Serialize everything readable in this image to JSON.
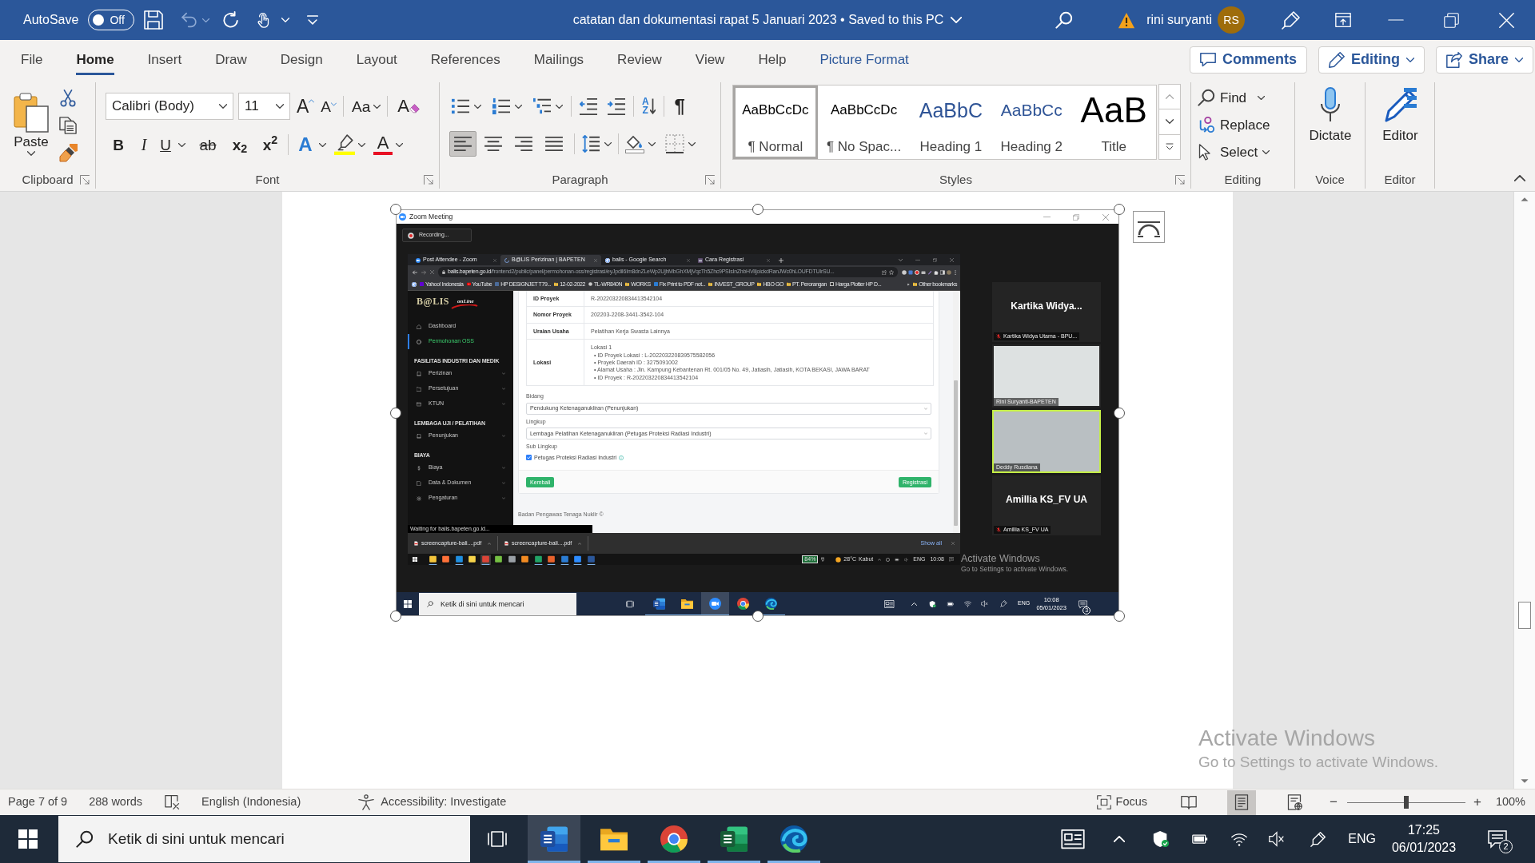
{
  "window": {
    "autosave_label": "AutoSave",
    "autosave": {
      "on": false,
      "label": "Off"
    },
    "title": "catatan dan dokumentasi rapat 5 Januari 2023 • Saved to this PC",
    "user_name": "rini suryanti",
    "user_initials": "RS"
  },
  "tabs": [
    {
      "label": "File",
      "kind": "standard",
      "selected": false
    },
    {
      "label": "Home",
      "kind": "standard",
      "selected": true
    },
    {
      "label": "Insert",
      "kind": "standard",
      "selected": false
    },
    {
      "label": "Draw",
      "kind": "standard",
      "selected": false
    },
    {
      "label": "Design",
      "kind": "standard",
      "selected": false
    },
    {
      "label": "Layout",
      "kind": "standard",
      "selected": false
    },
    {
      "label": "References",
      "kind": "standard",
      "selected": false
    },
    {
      "label": "Mailings",
      "kind": "standard",
      "selected": false
    },
    {
      "label": "Review",
      "kind": "standard",
      "selected": false
    },
    {
      "label": "View",
      "kind": "standard",
      "selected": false
    },
    {
      "label": "Help",
      "kind": "standard",
      "selected": false
    },
    {
      "label": "Picture Format",
      "kind": "contextual",
      "selected": false
    }
  ],
  "header_buttons": [
    {
      "label": "Comments",
      "dropdown": false
    },
    {
      "label": "Editing",
      "dropdown": true
    },
    {
      "label": "Share",
      "dropdown": true
    }
  ],
  "ribbon": {
    "clipboard": {
      "paste": "Paste",
      "label": "Clipboard"
    },
    "font": {
      "font_name": "Calibri (Body)",
      "font_size": "11",
      "grow": "A",
      "shrink": "A",
      "change_case": "Aa",
      "clear": "A",
      "bold": "B",
      "italic": "I",
      "underline": "U",
      "strikethrough": "ab",
      "subscript": "x$_{2}$",
      "superscript": "x$^{2}$",
      "text_effects": "A",
      "font_color": "A",
      "label": "Font"
    },
    "paragraph": {
      "sort": "AZ",
      "show_marks": "¶",
      "alignment": [
        {
          "selected": true
        },
        {
          "selected": false
        },
        {
          "selected": false
        },
        {
          "selected": false
        }
      ],
      "label": "Paragraph"
    },
    "styles": {
      "items": [
        {
          "kind": "normal",
          "preview": "AaBbCcDc",
          "name": "¶ Normal",
          "selected": true
        },
        {
          "kind": "no_spacing",
          "preview": "AaBbCcDc",
          "name": "¶ No Spac...",
          "selected": false
        },
        {
          "kind": "heading1",
          "preview": "AaBbC",
          "name": "Heading 1",
          "selected": false
        },
        {
          "kind": "heading2",
          "preview": "AaBbCc",
          "name": "Heading 2",
          "selected": false
        },
        {
          "kind": "title",
          "preview": "AaB",
          "name": "Title",
          "selected": false
        }
      ],
      "label": "Styles"
    },
    "editing": {
      "find": "Find",
      "replace": "Replace",
      "select": "Select",
      "label": "Editing"
    },
    "voice": {
      "dictate": "Dictate",
      "label": "Voice"
    },
    "editor": {
      "editor": "Editor",
      "label": "Editor"
    }
  },
  "document": {
    "zoom_meeting": {
      "title": "Zoom Meeting",
      "recording": "Recording...",
      "browser": {
        "tabs": [
          {
            "label": "Post Attendee - Zoom",
            "selected": false
          },
          {
            "label": "B@LIS Perizinan | BAPETEN",
            "selected": true
          },
          {
            "label": "balis - Google Search",
            "selected": false
          },
          {
            "label": "Cara Registrasi",
            "selected": false
          }
        ],
        "url_host": "balis.bapeten.go.id",
        "url_path": "/frontend2/public/panel/permohonan-oss/registrasi/eyJpdiI6Im8dnZLeWp2UjhMbGhXMjVqcTh5Zhc9PSIsInZhbHVlIjoickdRanJWc0hLOUFDTUIrSU...",
        "bookmarks": [
          "Yahoo! Indonesia",
          "YouTube",
          "HP DESIGNJET T79...",
          "12-02-2022",
          "TL-WR840N",
          "WORKS",
          "Fix Print to PDF not...",
          "INVEST_GROUP",
          "HBO GO",
          "PT. Perorangan",
          "Harga Plotter HP D..."
        ],
        "other_bookmarks": "Other bookmarks",
        "site": {
          "logo": "B@LIS",
          "logo_sub": "onLine",
          "nav": [
            {
              "items": [
                {
                  "label": "Dashboard",
                  "selected": false,
                  "submenu": false
                },
                {
                  "label": "Permohonan OSS",
                  "selected": true,
                  "submenu": false
                }
              ]
            },
            {
              "heading": "FASILITAS INDUSTRI DAN MEDIK",
              "items": [
                {
                  "label": "Perizinan",
                  "selected": false,
                  "submenu": true
                },
                {
                  "label": "Persetujuan",
                  "selected": false,
                  "submenu": true
                },
                {
                  "label": "KTUN",
                  "selected": false,
                  "submenu": true
                }
              ]
            },
            {
              "heading": "LEMBAGA UJI / PELATIHAN",
              "items": [
                {
                  "label": "Penunjukan",
                  "selected": false,
                  "submenu": true
                }
              ]
            },
            {
              "heading": "BIAYA",
              "items": [
                {
                  "label": "Biaya",
                  "selected": false,
                  "submenu": true
                },
                {
                  "label": "Data & Dokumen",
                  "selected": false,
                  "submenu": true
                },
                {
                  "label": "Pengaturan",
                  "selected": false,
                  "submenu": true
                }
              ]
            }
          ],
          "details": [
            {
              "label": "ID Proyek",
              "value": "R-202203220834413542104"
            },
            {
              "label": "Nomor Proyek",
              "value": "202203-2208-3441-3542-104"
            },
            {
              "label": "Uraian Usaha",
              "value": "Pelatihan Kerja Swasta Lainnya"
            },
            {
              "label": "Lokasi",
              "value": "Lokasi 1",
              "bullets": [
                "• ID Proyek Lokasi : L-202203220839575582056",
                "• Proyek Daerah ID : 3275091002",
                "• Alamat Usaha : Jln. Kampung Kebantenan Rt. 001/05 No. 49, Jatiasih, Jatiasih, KOTA BEKASI, JAWA BARAT",
                "• ID Proyek : R-202203220834413542104"
              ]
            }
          ],
          "selects": [
            {
              "label": "Bidang",
              "value": "Pendukung Ketenaganukliran (Penunjukan)"
            },
            {
              "label": "Lingkup",
              "value": "Lembaga Pelatihan Ketenaganukliran (Petugas Proteksi Radiasi Industri)"
            }
          ],
          "sub_scope": {
            "label": "Sub Lingkup",
            "options": [
              {
                "label": "Petugas Proteksi Radiasi Industri",
                "checked": true
              }
            ]
          },
          "back_button": "Kembali",
          "submit_button": "Registrasi",
          "footer": "Badan Pengawas Tenaga Nuklir ©"
        },
        "status": "Waiting for balis.bapeten.go.id...",
        "downloads": [
          "screencapture-bali....pdf",
          "screencapture-bali....pdf"
        ],
        "show_all": "Show all",
        "shared_taskbar": {
          "apps": [
            {
              "running": true,
              "selected": false
            },
            {
              "running": false,
              "selected": false
            },
            {
              "running": true,
              "selected": false
            },
            {
              "running": false,
              "selected": false
            },
            {
              "running": true,
              "selected": true
            },
            {
              "running": false,
              "selected": false
            },
            {
              "running": false,
              "selected": false
            },
            {
              "running": false,
              "selected": false
            },
            {
              "running": true,
              "selected": false
            },
            {
              "running": true,
              "selected": false
            },
            {
              "running": true,
              "selected": false
            },
            {
              "running": true,
              "selected": false
            },
            {
              "running": true,
              "selected": false
            }
          ],
          "battery": "84%",
          "temperature": "28°C",
          "weather": "Kabut",
          "language": "ENG",
          "time": "10:08"
        }
      },
      "participants": [
        {
          "kind": "name_tile",
          "name": "Kartika Widya...",
          "label": "Kartika Widya Utama - BPU...",
          "muted": true,
          "speaking": false
        },
        {
          "kind": "video",
          "label": "Rini Suryanti-BAPETEN",
          "muted": false,
          "speaking": false
        },
        {
          "kind": "video",
          "label": "Deddy Rusdiana",
          "muted": false,
          "speaking": true
        },
        {
          "kind": "name_tile",
          "name": "Amillia KS_FV UA",
          "label": "Amillia KS_FV UA",
          "muted": true,
          "speaking": false
        }
      ],
      "activation": {
        "title": "Activate Windows",
        "hint": "Go to Settings to activate Windows."
      },
      "taskbar": {
        "search_placeholder": "Ketik di sini untuk mencari",
        "apps": [
          {
            "running": true,
            "selected": false
          },
          {
            "running": true,
            "selected": false
          },
          {
            "running": true,
            "selected": true
          },
          {
            "running": false,
            "selected": false
          },
          {
            "running": true,
            "selected": false
          }
        ],
        "language": "ENG",
        "time": "10:08",
        "date": "05/01/2023",
        "notifications": "3"
      }
    },
    "activation": {
      "title": "Activate Windows",
      "hint": "Go to Settings to activate Windows."
    }
  },
  "status_bar": {
    "page": "Page 7 of 9",
    "words": "288 words",
    "language": "English (Indonesia)",
    "accessibility": "Accessibility: Investigate",
    "focus": "Focus",
    "views": [
      {
        "selected": false
      },
      {
        "selected": true
      },
      {
        "selected": false
      }
    ],
    "zoom_out": "−",
    "zoom_slider": {
      "level": 0.5
    },
    "zoom_in": "+",
    "zoom": "100%"
  },
  "taskbar": {
    "search_placeholder": "Ketik di sini untuk mencari",
    "apps": [
      {
        "selected": true,
        "running": true
      },
      {
        "selected": false,
        "running": true
      },
      {
        "selected": false,
        "running": true
      },
      {
        "selected": false,
        "running": true
      },
      {
        "selected": false,
        "running": true
      }
    ],
    "language": "ENG",
    "time": "17:25",
    "date": "06/01/2023",
    "notifications": "2"
  }
}
